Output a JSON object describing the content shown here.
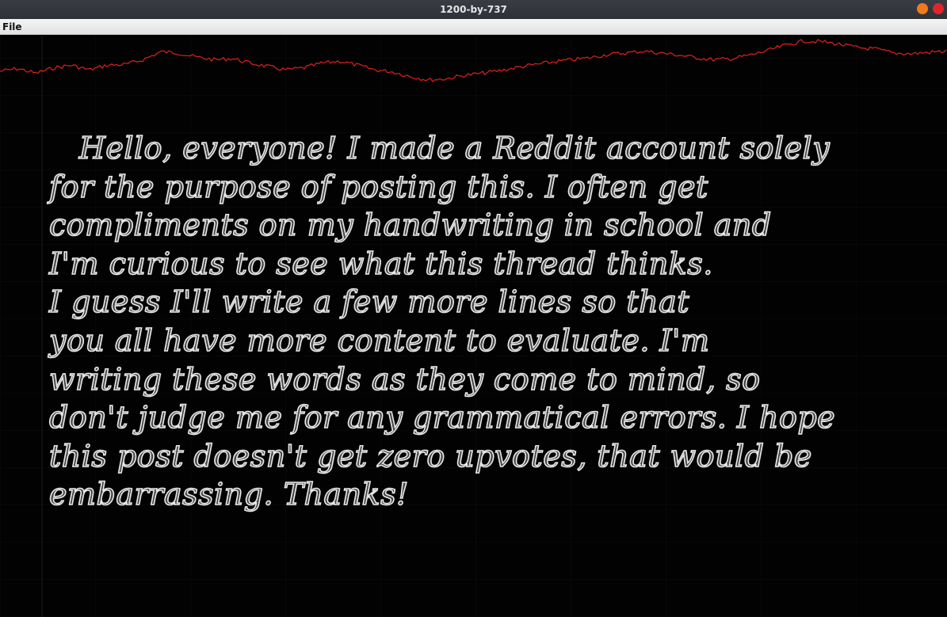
{
  "window": {
    "title": "1200-by-737"
  },
  "menubar": {
    "items": [
      {
        "label": "File"
      }
    ]
  },
  "canvas": {
    "trace_color": "#e0201c",
    "trace_shape": [
      0.47,
      0.43,
      0.5,
      0.42,
      0.38,
      0.45,
      0.38,
      0.37,
      0.3,
      0.18,
      0.2,
      0.26,
      0.3,
      0.28,
      0.35,
      0.4,
      0.45,
      0.42,
      0.35,
      0.32,
      0.38,
      0.45,
      0.48,
      0.55,
      0.6,
      0.58,
      0.53,
      0.5,
      0.46,
      0.41,
      0.37,
      0.33,
      0.3,
      0.27,
      0.22,
      0.2,
      0.17,
      0.2,
      0.23,
      0.27,
      0.3,
      0.28,
      0.23,
      0.16,
      0.08,
      0.02,
      0.03,
      0.07,
      0.12,
      0.14,
      0.2,
      0.21,
      0.19,
      0.17
    ],
    "handwriting_lines": [
      "   Hello, everyone! I made a Reddit account solely",
      "for the purpose of posting this. I often get",
      "compliments on my handwriting in school and",
      "I'm curious to see what this thread thinks.",
      "I guess I'll write a few more lines so that",
      "you all have more content to evaluate. I'm",
      "writing these words as they come to mind, so",
      "don't judge me for any grammatical errors. I hope",
      "this post doesn't get zero upvotes, that would be",
      "embarrassing. Thanks!"
    ]
  }
}
